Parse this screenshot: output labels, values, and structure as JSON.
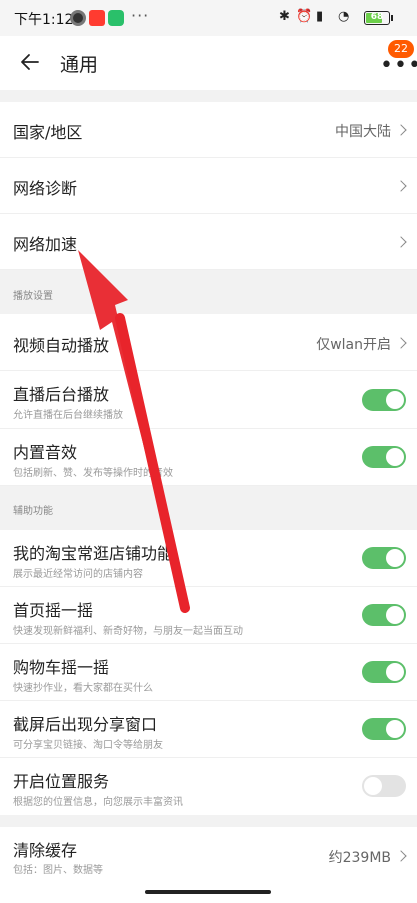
{
  "status_bar": {
    "time": "下午1:12",
    "dots": "···"
  },
  "header": {
    "title": "通用",
    "badge_count": "22"
  },
  "rows_top": [
    {
      "label": "国家/地区",
      "value": "中国大陆"
    },
    {
      "label": "网络诊断",
      "value": ""
    },
    {
      "label": "网络加速",
      "value": ""
    }
  ],
  "playback_section": {
    "title": "播放设置",
    "autoplay": {
      "label": "视频自动播放",
      "value": "仅wlan开启"
    },
    "live_bg": {
      "label": "直播后台播放",
      "sub": "允许直播在后台继续播放",
      "on": true
    },
    "builtin_sound": {
      "label": "内置音效",
      "sub": "包括刷新、赞、发布等操作时的音效",
      "on": true
    }
  },
  "assist_section": {
    "title": "辅助功能",
    "items": [
      {
        "label": "我的淘宝常逛店铺功能",
        "sub": "展示最近经常访问的店铺内容",
        "on": true
      },
      {
        "label": "首页摇一摇",
        "sub": "快速发现新鲜福利、新奇好物，与朋友一起当面互动",
        "on": true
      },
      {
        "label": "购物车摇一摇",
        "sub": "快速抄作业，看大家都在买什么",
        "on": true
      },
      {
        "label": "截屏后出现分享窗口",
        "sub": "可分享宝贝链接、淘口令等给朋友",
        "on": true
      },
      {
        "label": "开启位置服务",
        "sub": "根据您的位置信息，向您展示丰富资讯",
        "on": false
      }
    ]
  },
  "clear_cache": {
    "label": "清除缓存",
    "sub": "包括：图片、数据等",
    "value": "约239MB"
  },
  "colors": {
    "toggle_on": "#5cbf6a",
    "badge": "#ff5a00",
    "annotation_arrow": "#e8242b"
  }
}
